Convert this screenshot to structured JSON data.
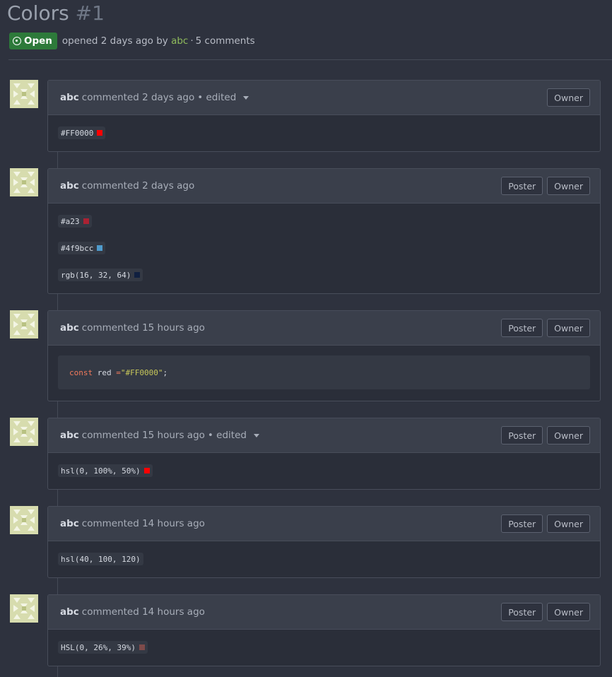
{
  "issue": {
    "title": "Colors",
    "number": "#1",
    "status": "Open",
    "opened_text": "opened 2 days ago by",
    "opened_by": "abc",
    "separator": "·",
    "comments_count": "5 comments"
  },
  "comments": [
    {
      "author": "abc",
      "time": "commented 2 days ago",
      "edited": "• edited",
      "roles": [
        "Owner"
      ],
      "codes": [
        {
          "text": "#FF0000",
          "color": "#ff0000"
        }
      ]
    },
    {
      "author": "abc",
      "time": "commented 2 days ago",
      "roles": [
        "Poster",
        "Owner"
      ],
      "codes": [
        {
          "text": "#a23",
          "color": "#aa2233"
        },
        {
          "text": "#4f9bcc",
          "color": "#4f9bcc"
        },
        {
          "text": "rgb(16, 32, 64)",
          "color": "#102040"
        }
      ]
    },
    {
      "author": "abc",
      "time": "commented 15 hours ago",
      "roles": [
        "Poster",
        "Owner"
      ],
      "block": {
        "keyword": "const",
        "name": " red ",
        "op": "=",
        "string": " \"#FF0000\"",
        "end": ";"
      }
    },
    {
      "author": "abc",
      "time": "commented 15 hours ago",
      "edited": "• edited",
      "roles": [
        "Poster",
        "Owner"
      ],
      "codes": [
        {
          "text": "hsl(0, 100%, 50%)",
          "color": "#ff0000"
        }
      ]
    },
    {
      "author": "abc",
      "time": "commented 14 hours ago",
      "roles": [
        "Poster",
        "Owner"
      ],
      "codes": [
        {
          "text": "hsl(40, 100, 120)"
        }
      ]
    },
    {
      "author": "abc",
      "time": "commented 14 hours ago",
      "roles": [
        "Poster",
        "Owner"
      ],
      "codes": [
        {
          "text": "HSL(0, 26%, 39%)",
          "color": "#7e4a4a"
        }
      ]
    }
  ]
}
